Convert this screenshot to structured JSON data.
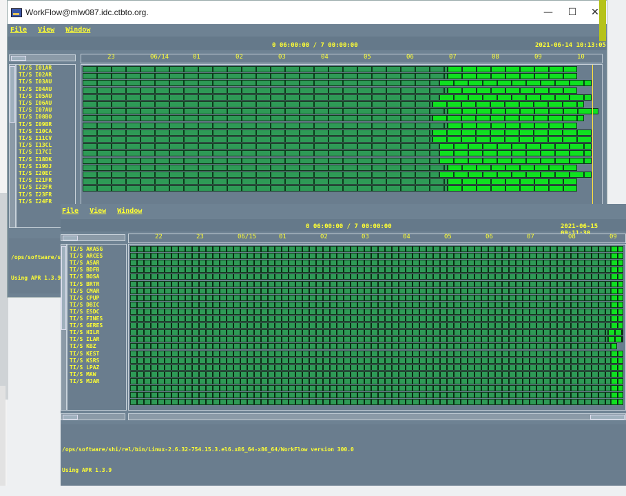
{
  "back_window": {
    "title": "WorkFlow@mlw087.idc.ctbto.org.",
    "controls": {
      "minimize": "—",
      "maximize": "☐",
      "close": "✕"
    },
    "menu": [
      "File",
      "View",
      "Window"
    ],
    "header": {
      "range": "0 06:00:00 / 7 00:00:00",
      "datetime": "2021-06-14 10:13:05"
    },
    "axis_ticks": [
      "23",
      "06/14",
      "01",
      "02",
      "03",
      "04",
      "05",
      "06",
      "07",
      "08",
      "09",
      "10"
    ],
    "rows": [
      "TI/S I01AR",
      "TI/S I02AR",
      "TI/S I03AU",
      "TI/S I04AU",
      "TI/S I05AU",
      "TI/S I06AU",
      "TI/S I07AU",
      "TI/S I08BO",
      "TI/S I09BR",
      "TI/S I10CA",
      "TI/S I11CV",
      "TI/S I13CL",
      "TI/S I17CI",
      "TI/S I18DK",
      "TI/S I19DJ",
      "TI/S I20EC",
      "TI/S I21FR",
      "TI/S I22FR",
      "TI/S I23FR",
      "TI/S I24FR"
    ],
    "console_lines": [
      "/ops/software/sh",
      "Using APR 1.3.9"
    ]
  },
  "front_window": {
    "menu": [
      "File",
      "View",
      "Window"
    ],
    "header": {
      "range": "0 06:00:00 / 7 00:00:00",
      "datetime": "2021-06-15 09:11:30"
    },
    "axis_ticks": [
      "22",
      "23",
      "06/15",
      "01",
      "02",
      "03",
      "04",
      "05",
      "06",
      "07",
      "08",
      "09"
    ],
    "rows": [
      "TI/S AKASG",
      "TI/S ARCES",
      "TI/S ASAR",
      "TI/S BDFB",
      "TI/S BOSA",
      "TI/S BRTR",
      "TI/S CMAR",
      "TI/S CPUP",
      "TI/S DBIC",
      "TI/S ESDC",
      "TI/S FINES",
      "TI/S GERES",
      "TI/S HILR",
      "TI/S ILAR",
      "TI/S KBZ",
      "TI/S KEST",
      "TI/S KSRS",
      "TI/S LPAZ",
      "TI/S MAW",
      "TI/S MJAR"
    ],
    "console_lines": [
      "/ops/software/shi/rel/bin/Linux-2.6.32-754.15.3.el6.x86_64-x86_64/WorkFlow version 300.0",
      "Using APR 1.3.9"
    ]
  },
  "colors": {
    "bg": "#6e8293",
    "text": "#ffff33",
    "bar_processed": "#2e9a56",
    "bar_recent": "#10e020",
    "now_line": "#ffe040"
  }
}
